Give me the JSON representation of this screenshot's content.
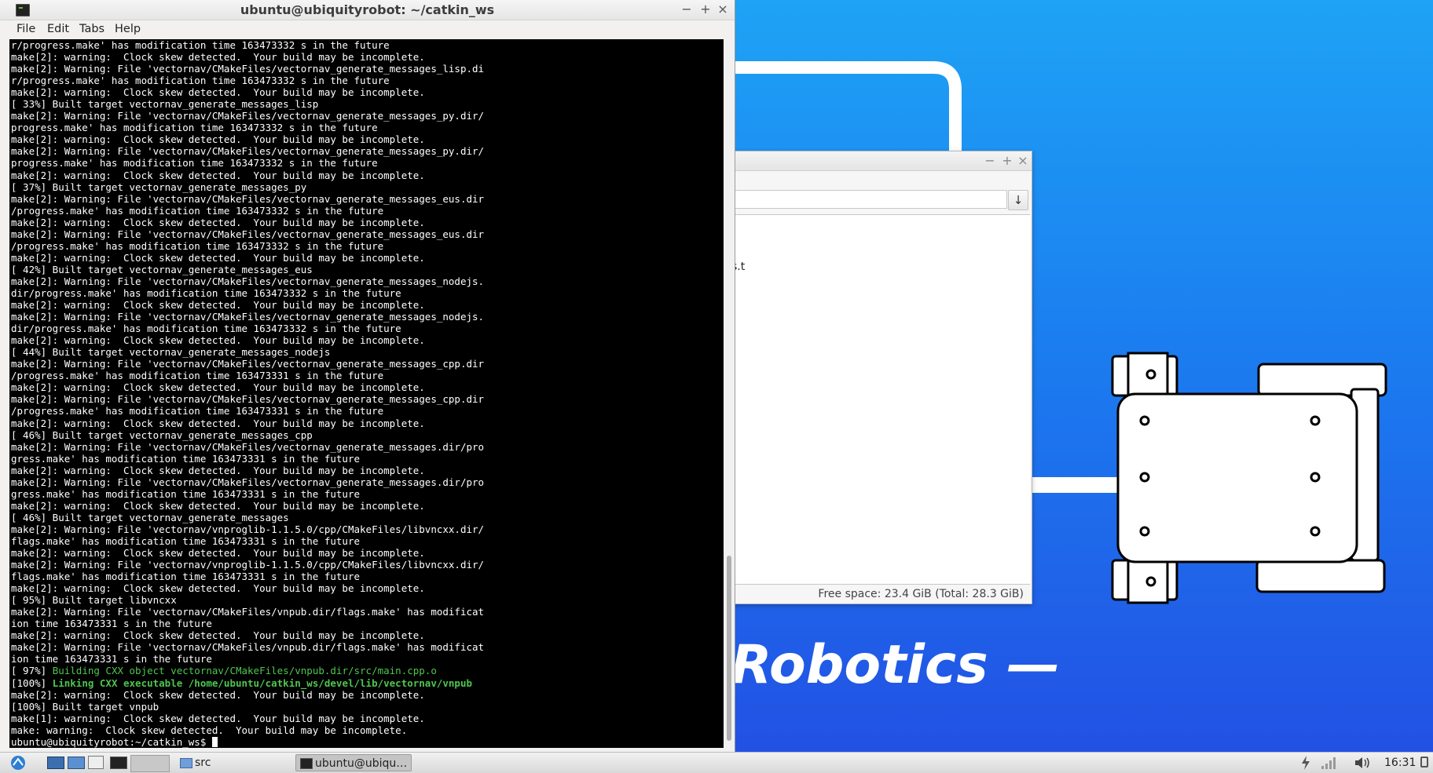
{
  "desktop": {
    "wallpaper_text": "Robotics —",
    "colors": {
      "top": "#1ea3f5",
      "bottom": "#2251e4"
    }
  },
  "file_manager": {
    "file_fragment": "s.t",
    "status": "Free space: 23.4 GiB (Total: 28.3 GiB)"
  },
  "terminal": {
    "title": "ubuntu@ubiquityrobot: ~/catkin_ws",
    "menu": [
      "File",
      "Edit",
      "Tabs",
      "Help"
    ],
    "prompt": "ubuntu@ubiquityrobot:~/catkin_ws$ ",
    "lines": [
      "r/progress.make' has modification time 163473332 s in the future",
      "make[2]: warning:  Clock skew detected.  Your build may be incomplete.",
      "make[2]: Warning: File 'vectornav/CMakeFiles/vectornav_generate_messages_lisp.di",
      "r/progress.make' has modification time 163473332 s in the future",
      "make[2]: warning:  Clock skew detected.  Your build may be incomplete.",
      "[ 33%] Built target vectornav_generate_messages_lisp",
      "make[2]: Warning: File 'vectornav/CMakeFiles/vectornav_generate_messages_py.dir/",
      "progress.make' has modification time 163473332 s in the future",
      "make[2]: warning:  Clock skew detected.  Your build may be incomplete.",
      "make[2]: Warning: File 'vectornav/CMakeFiles/vectornav_generate_messages_py.dir/",
      "progress.make' has modification time 163473332 s in the future",
      "make[2]: warning:  Clock skew detected.  Your build may be incomplete.",
      "[ 37%] Built target vectornav_generate_messages_py",
      "make[2]: Warning: File 'vectornav/CMakeFiles/vectornav_generate_messages_eus.dir",
      "/progress.make' has modification time 163473332 s in the future",
      "make[2]: warning:  Clock skew detected.  Your build may be incomplete.",
      "make[2]: Warning: File 'vectornav/CMakeFiles/vectornav_generate_messages_eus.dir",
      "/progress.make' has modification time 163473332 s in the future",
      "make[2]: warning:  Clock skew detected.  Your build may be incomplete.",
      "[ 42%] Built target vectornav_generate_messages_eus",
      "make[2]: Warning: File 'vectornav/CMakeFiles/vectornav_generate_messages_nodejs.",
      "dir/progress.make' has modification time 163473332 s in the future",
      "make[2]: warning:  Clock skew detected.  Your build may be incomplete.",
      "make[2]: Warning: File 'vectornav/CMakeFiles/vectornav_generate_messages_nodejs.",
      "dir/progress.make' has modification time 163473332 s in the future",
      "make[2]: warning:  Clock skew detected.  Your build may be incomplete.",
      "[ 44%] Built target vectornav_generate_messages_nodejs",
      "make[2]: Warning: File 'vectornav/CMakeFiles/vectornav_generate_messages_cpp.dir",
      "/progress.make' has modification time 163473331 s in the future",
      "make[2]: warning:  Clock skew detected.  Your build may be incomplete.",
      "make[2]: Warning: File 'vectornav/CMakeFiles/vectornav_generate_messages_cpp.dir",
      "/progress.make' has modification time 163473331 s in the future",
      "make[2]: warning:  Clock skew detected.  Your build may be incomplete.",
      "[ 46%] Built target vectornav_generate_messages_cpp",
      "make[2]: Warning: File 'vectornav/CMakeFiles/vectornav_generate_messages.dir/pro",
      "gress.make' has modification time 163473331 s in the future",
      "make[2]: warning:  Clock skew detected.  Your build may be incomplete.",
      "make[2]: Warning: File 'vectornav/CMakeFiles/vectornav_generate_messages.dir/pro",
      "gress.make' has modification time 163473331 s in the future",
      "make[2]: warning:  Clock skew detected.  Your build may be incomplete.",
      "[ 46%] Built target vectornav_generate_messages",
      "make[2]: Warning: File 'vectornav/vnproglib-1.1.5.0/cpp/CMakeFiles/libvncxx.dir/",
      "flags.make' has modification time 163473331 s in the future",
      "make[2]: warning:  Clock skew detected.  Your build may be incomplete.",
      "make[2]: Warning: File 'vectornav/vnproglib-1.1.5.0/cpp/CMakeFiles/libvncxx.dir/",
      "flags.make' has modification time 163473331 s in the future",
      "make[2]: warning:  Clock skew detected.  Your build may be incomplete.",
      "[ 95%] Built target libvncxx",
      "make[2]: Warning: File 'vectornav/CMakeFiles/vnpub.dir/flags.make' has modificat",
      "ion time 163473331 s in the future",
      "make[2]: warning:  Clock skew detected.  Your build may be incomplete.",
      "make[2]: Warning: File 'vectornav/CMakeFiles/vnpub.dir/flags.make' has modificat",
      "ion time 163473331 s in the future"
    ],
    "building": {
      "prefix": "[ 97%] ",
      "text": "Building CXX object vectornav/CMakeFiles/vnpub.dir/src/main.cpp.o"
    },
    "linking": {
      "prefix": "[100%] ",
      "text": "Linking CXX executable /home/ubuntu/catkin_ws/devel/lib/vectornav/vnpub"
    },
    "tail_lines": [
      "make[2]: warning:  Clock skew detected.  Your build may be incomplete.",
      "[100%] Built target vnpub",
      "make[1]: warning:  Clock skew detected.  Your build may be incomplete.",
      "make: warning:  Clock skew detected.  Your build may be incomplete."
    ],
    "colors": {
      "background": "#000000",
      "text": "#ffffff",
      "green": "#4ec64e"
    }
  },
  "taskbar": {
    "tasks": [
      {
        "label": "src",
        "icon": "folder-icon"
      },
      {
        "label": "ubuntu@ubiqu…",
        "icon": "terminal-icon"
      }
    ],
    "clock": "16:31"
  }
}
